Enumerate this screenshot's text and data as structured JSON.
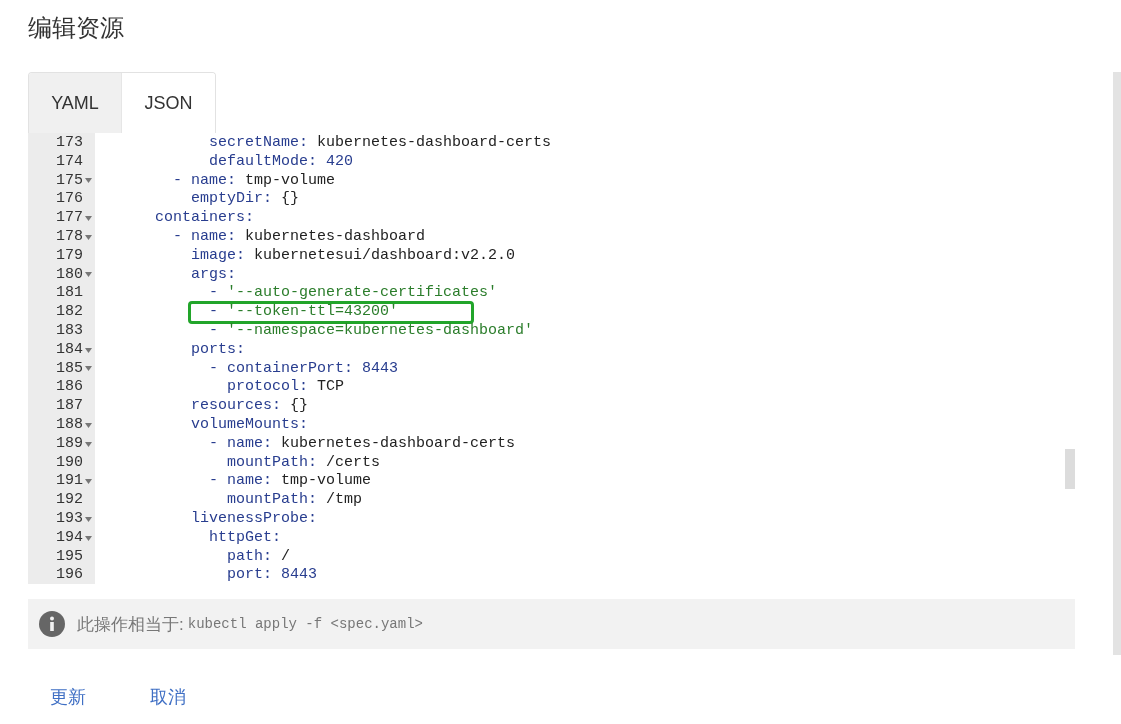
{
  "title": "编辑资源",
  "tabs": [
    {
      "label": "YAML",
      "selected": true
    },
    {
      "label": "JSON",
      "selected": false
    }
  ],
  "editor": {
    "lines": [
      {
        "number": "173",
        "foldable": false,
        "highlighted": false,
        "tokens": [
          {
            "kind": "key",
            "text": "            secretName"
          },
          {
            "kind": "punct",
            "text": ": "
          },
          {
            "kind": "value",
            "text": "kubernetes-dashboard-certs"
          }
        ]
      },
      {
        "number": "174",
        "foldable": false,
        "highlighted": false,
        "tokens": [
          {
            "kind": "key",
            "text": "            defaultMode"
          },
          {
            "kind": "punct",
            "text": ": "
          },
          {
            "kind": "number",
            "text": "420"
          }
        ]
      },
      {
        "number": "175",
        "foldable": true,
        "highlighted": false,
        "tokens": [
          {
            "kind": "dash",
            "text": "        - "
          },
          {
            "kind": "key",
            "text": "name"
          },
          {
            "kind": "punct",
            "text": ": "
          },
          {
            "kind": "value",
            "text": "tmp-volume"
          }
        ]
      },
      {
        "number": "176",
        "foldable": false,
        "highlighted": false,
        "tokens": [
          {
            "kind": "key",
            "text": "          emptyDir"
          },
          {
            "kind": "punct",
            "text": ": "
          },
          {
            "kind": "value",
            "text": "{}"
          }
        ]
      },
      {
        "number": "177",
        "foldable": true,
        "highlighted": false,
        "tokens": [
          {
            "kind": "key",
            "text": "      containers"
          },
          {
            "kind": "punct",
            "text": ":"
          }
        ]
      },
      {
        "number": "178",
        "foldable": true,
        "highlighted": false,
        "tokens": [
          {
            "kind": "dash",
            "text": "        - "
          },
          {
            "kind": "key",
            "text": "name"
          },
          {
            "kind": "punct",
            "text": ": "
          },
          {
            "kind": "value",
            "text": "kubernetes-dashboard"
          }
        ]
      },
      {
        "number": "179",
        "foldable": false,
        "highlighted": false,
        "tokens": [
          {
            "kind": "key",
            "text": "          image"
          },
          {
            "kind": "punct",
            "text": ": "
          },
          {
            "kind": "value",
            "text": "kubernetesui/dashboard:v2.2.0"
          }
        ]
      },
      {
        "number": "180",
        "foldable": true,
        "highlighted": false,
        "tokens": [
          {
            "kind": "key",
            "text": "          args"
          },
          {
            "kind": "punct",
            "text": ":"
          }
        ]
      },
      {
        "number": "181",
        "foldable": false,
        "highlighted": false,
        "tokens": [
          {
            "kind": "dash",
            "text": "            - "
          },
          {
            "kind": "string",
            "text": "'--auto-generate-certificates'"
          }
        ]
      },
      {
        "number": "182",
        "foldable": false,
        "highlighted": true,
        "tokens": [
          {
            "kind": "dash",
            "text": "            - "
          },
          {
            "kind": "string",
            "text": "'--token-ttl=43200'"
          }
        ]
      },
      {
        "number": "183",
        "foldable": false,
        "highlighted": false,
        "tokens": [
          {
            "kind": "dash",
            "text": "            - "
          },
          {
            "kind": "string",
            "text": "'--namespace=kubernetes-dashboard'"
          }
        ]
      },
      {
        "number": "184",
        "foldable": true,
        "highlighted": false,
        "tokens": [
          {
            "kind": "key",
            "text": "          ports"
          },
          {
            "kind": "punct",
            "text": ":"
          }
        ]
      },
      {
        "number": "185",
        "foldable": true,
        "highlighted": false,
        "tokens": [
          {
            "kind": "dash",
            "text": "            - "
          },
          {
            "kind": "key",
            "text": "containerPort"
          },
          {
            "kind": "punct",
            "text": ": "
          },
          {
            "kind": "number",
            "text": "8443"
          }
        ]
      },
      {
        "number": "186",
        "foldable": false,
        "highlighted": false,
        "tokens": [
          {
            "kind": "key",
            "text": "              protocol"
          },
          {
            "kind": "punct",
            "text": ": "
          },
          {
            "kind": "value",
            "text": "TCP"
          }
        ]
      },
      {
        "number": "187",
        "foldable": false,
        "highlighted": false,
        "tokens": [
          {
            "kind": "key",
            "text": "          resources"
          },
          {
            "kind": "punct",
            "text": ": "
          },
          {
            "kind": "value",
            "text": "{}"
          }
        ]
      },
      {
        "number": "188",
        "foldable": true,
        "highlighted": false,
        "tokens": [
          {
            "kind": "key",
            "text": "          volumeMounts"
          },
          {
            "kind": "punct",
            "text": ":"
          }
        ]
      },
      {
        "number": "189",
        "foldable": true,
        "highlighted": false,
        "tokens": [
          {
            "kind": "dash",
            "text": "            - "
          },
          {
            "kind": "key",
            "text": "name"
          },
          {
            "kind": "punct",
            "text": ": "
          },
          {
            "kind": "value",
            "text": "kubernetes-dashboard-certs"
          }
        ]
      },
      {
        "number": "190",
        "foldable": false,
        "highlighted": false,
        "tokens": [
          {
            "kind": "key",
            "text": "              mountPath"
          },
          {
            "kind": "punct",
            "text": ": "
          },
          {
            "kind": "value",
            "text": "/certs"
          }
        ]
      },
      {
        "number": "191",
        "foldable": true,
        "highlighted": false,
        "tokens": [
          {
            "kind": "dash",
            "text": "            - "
          },
          {
            "kind": "key",
            "text": "name"
          },
          {
            "kind": "punct",
            "text": ": "
          },
          {
            "kind": "value",
            "text": "tmp-volume"
          }
        ]
      },
      {
        "number": "192",
        "foldable": false,
        "highlighted": false,
        "tokens": [
          {
            "kind": "key",
            "text": "              mountPath"
          },
          {
            "kind": "punct",
            "text": ": "
          },
          {
            "kind": "value",
            "text": "/tmp"
          }
        ]
      },
      {
        "number": "193",
        "foldable": true,
        "highlighted": false,
        "tokens": [
          {
            "kind": "key",
            "text": "          livenessProbe"
          },
          {
            "kind": "punct",
            "text": ":"
          }
        ]
      },
      {
        "number": "194",
        "foldable": true,
        "highlighted": false,
        "tokens": [
          {
            "kind": "key",
            "text": "            httpGet"
          },
          {
            "kind": "punct",
            "text": ":"
          }
        ]
      },
      {
        "number": "195",
        "foldable": false,
        "highlighted": false,
        "tokens": [
          {
            "kind": "key",
            "text": "              path"
          },
          {
            "kind": "punct",
            "text": ": "
          },
          {
            "kind": "value",
            "text": "/"
          }
        ]
      },
      {
        "number": "196",
        "foldable": false,
        "highlighted": false,
        "tokens": [
          {
            "kind": "key",
            "text": "              port"
          },
          {
            "kind": "punct",
            "text": ": "
          },
          {
            "kind": "number",
            "text": "8443"
          }
        ]
      }
    ]
  },
  "info": {
    "label": "此操作相当于:",
    "command": "kubectl apply -f <spec.yaml>"
  },
  "actions": [
    {
      "label": "更新"
    },
    {
      "label": "取消"
    }
  ]
}
